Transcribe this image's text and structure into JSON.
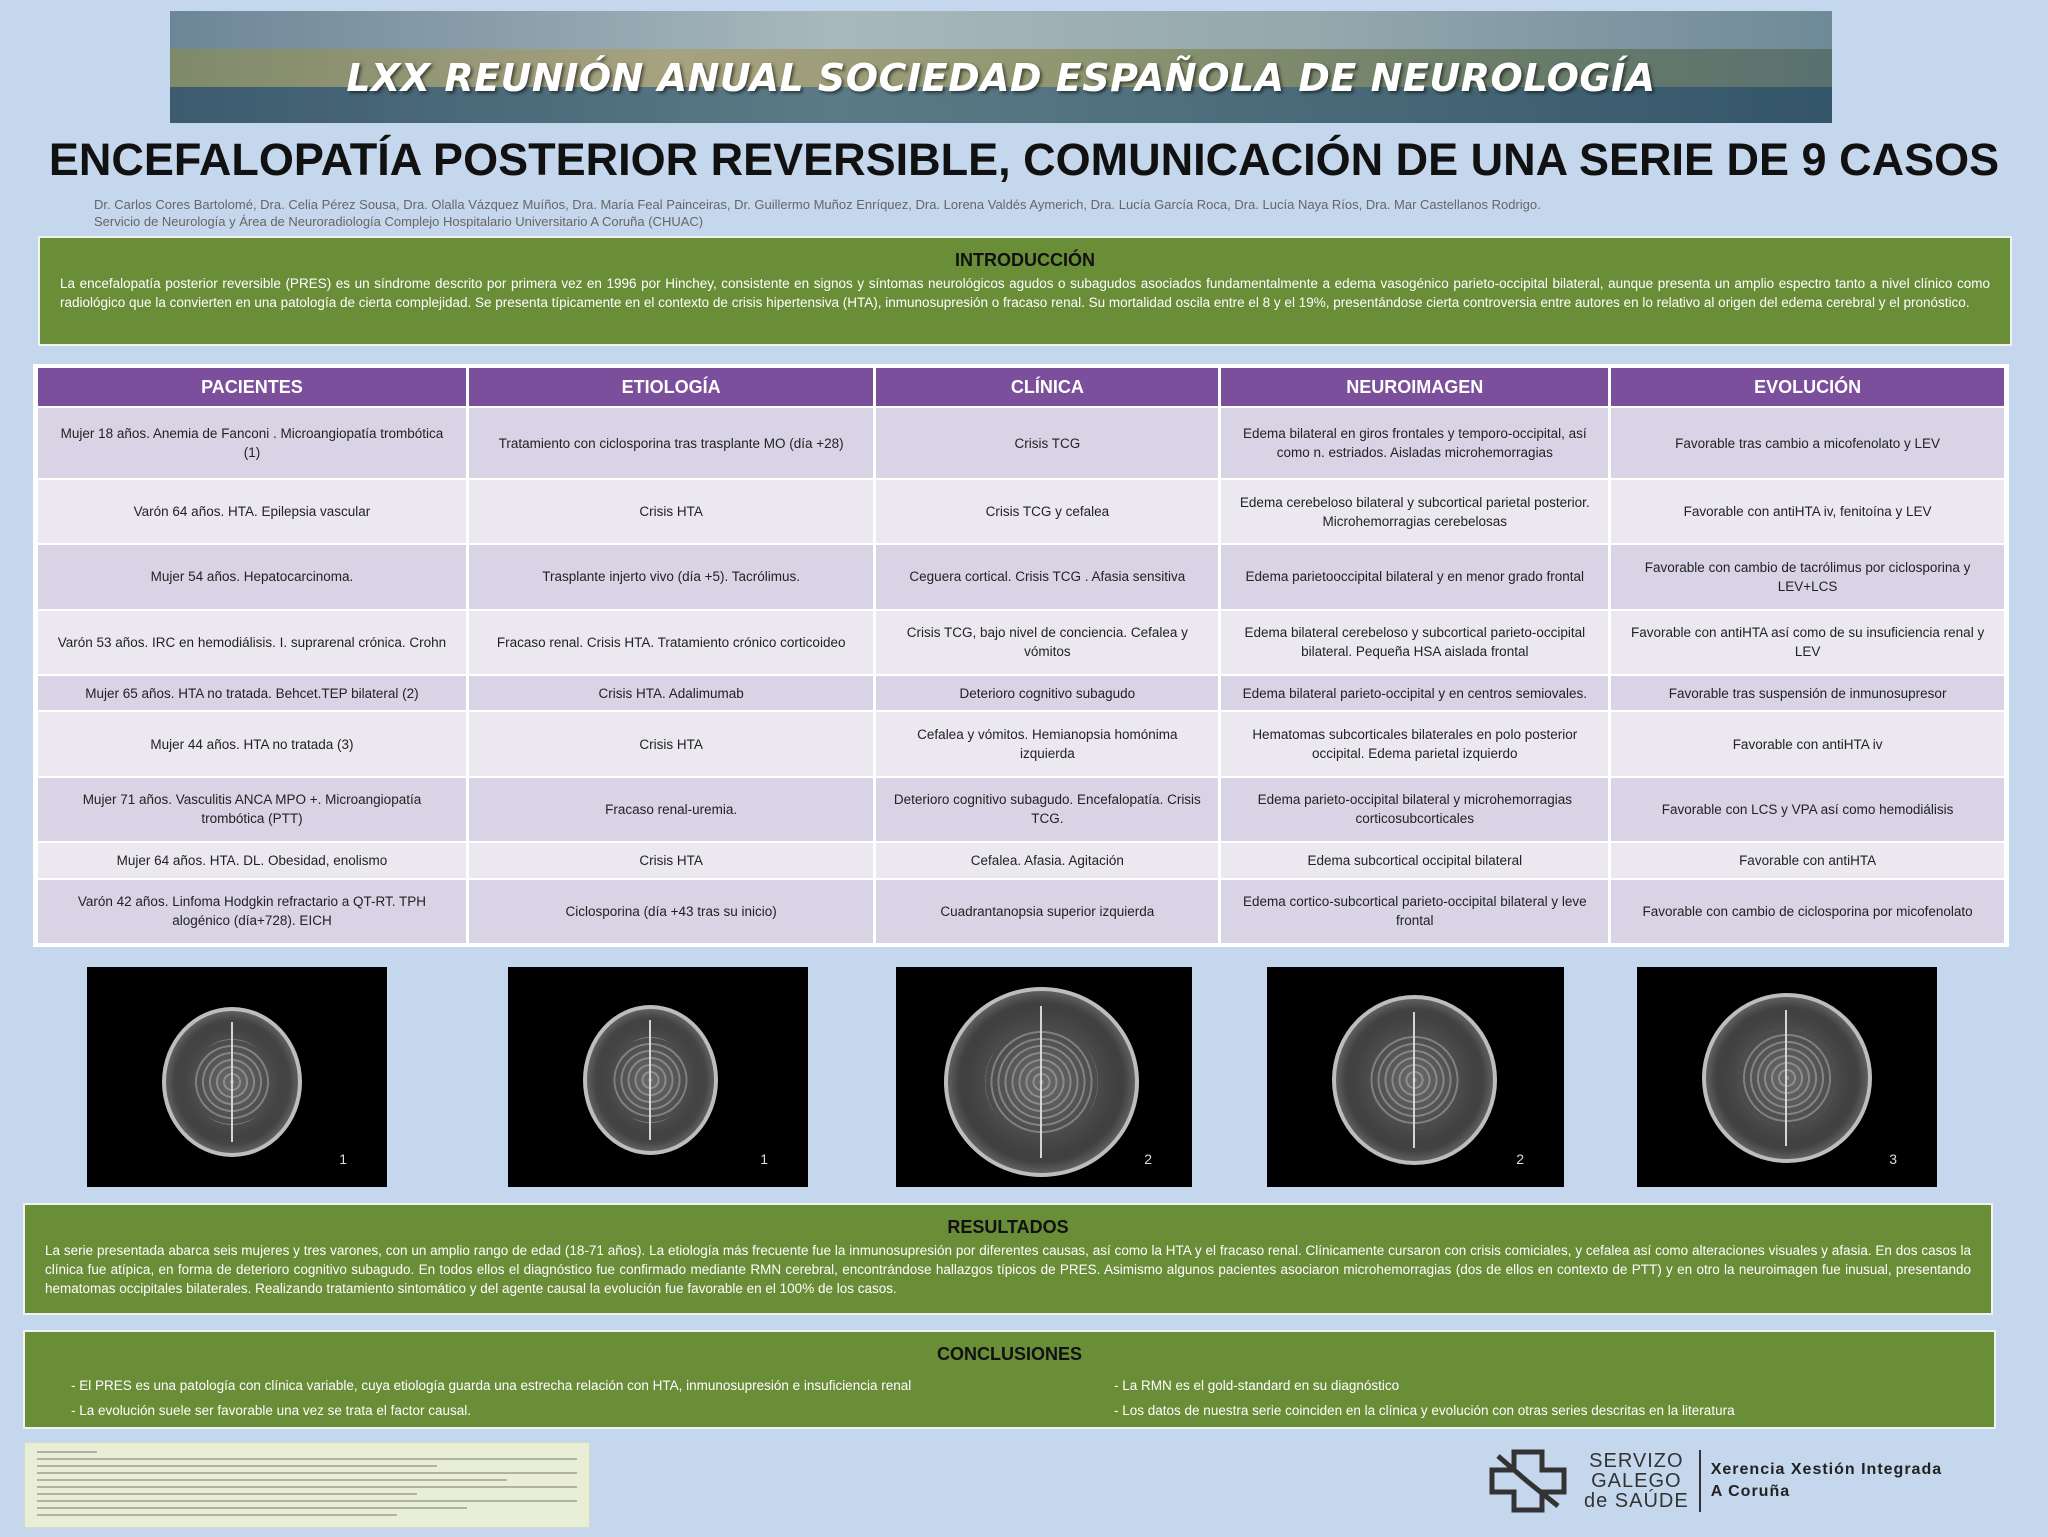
{
  "banner": {
    "title": "LXX REUNIÓN ANUAL SOCIEDAD ESPAÑOLA DE NEUROLOGÍA"
  },
  "title": "ENCEFALOPATÍA POSTERIOR REVERSIBLE, COMUNICACIÓN DE UNA SERIE DE 9 CASOS",
  "authors": {
    "line1": "Dr. Carlos Cores Bartolomé, Dra. Celia Pérez Sousa, Dra. Olalla Vázquez Muíños, Dra. María Feal Painceiras, Dr. Guillermo Muñoz Enríquez, Dra. Lorena Valdés Aymerich, Dra. Lucía García Roca, Dra. Lucía Naya Ríos, Dra. Mar Castellanos Rodrigo.",
    "line2": "Servicio de Neurología y Área de Neuroradiología Complejo Hospitalario Universitario A Coruña (CHUAC)"
  },
  "intro": {
    "heading": "INTRODUCCIÓN",
    "text": "La encefalopatía posterior reversible (PRES) es un síndrome descrito por primera vez en 1996 por Hinchey, consistente en signos y síntomas neurológicos agudos o subagudos asociados fundamentalmente a edema vasogénico parieto-occipital bilateral, aunque presenta un amplio espectro tanto a nivel clínico como radiológico que la convierten en una patología de cierta complejidad. Se presenta típicamente en el contexto de crisis hipertensiva (HTA), inmunosupresión o fracaso renal. Su mortalidad oscila entre el 8 y el 19%, presentándose cierta controversia entre autores en lo relativo al origen del edema cerebral y el pronóstico."
  },
  "table": {
    "headers": [
      "PACIENTES",
      "ETIOLOGÍA",
      "CLÍNICA",
      "NEUROIMAGEN",
      "EVOLUCIÓN"
    ],
    "rows": [
      [
        "Mujer 18 años. Anemia de Fanconi . Microangiopatía trombótica (1)",
        "Tratamiento con ciclosporina tras trasplante MO (día +28)",
        "Crisis TCG",
        "Edema bilateral en giros frontales y temporo-occipital, así como n. estriados. Aisladas microhemorragias",
        "Favorable tras cambio a micofenolato y LEV"
      ],
      [
        "Varón 64 años. HTA. Epilepsia vascular",
        "Crisis HTA",
        "Crisis TCG y cefalea",
        "Edema cerebeloso bilateral y subcortical parietal posterior. Microhemorragias cerebelosas",
        "Favorable con antiHTA iv, fenitoína y LEV"
      ],
      [
        "Mujer 54 años. Hepatocarcinoma.",
        "Trasplante injerto vivo (día +5). Tacrólimus.",
        "Ceguera cortical. Crisis TCG . Afasia sensitiva",
        "Edema parietooccipital bilateral y en menor grado frontal",
        "Favorable con cambio de tacrólimus por ciclosporina y LEV+LCS"
      ],
      [
        "Varón 53 años. IRC en hemodiálisis. I. suprarenal crónica. Crohn",
        "Fracaso renal. Crisis HTA. Tratamiento crónico corticoideo",
        "Crisis TCG, bajo nivel de conciencia. Cefalea y vómitos",
        "Edema bilateral cerebeloso y subcortical parieto-occipital bilateral. Pequeña HSA aislada frontal",
        "Favorable con antiHTA así como de su insuficiencia renal y LEV"
      ],
      [
        "Mujer 65 años. HTA no tratada. Behcet.TEP bilateral (2)",
        "Crisis HTA. Adalimumab",
        "Deterioro cognitivo subagudo",
        "Edema bilateral parieto-occipital y en centros semiovales.",
        "Favorable tras suspensión de inmunosupresor"
      ],
      [
        "Mujer 44 años. HTA no tratada (3)",
        "Crisis HTA",
        "Cefalea y vómitos. Hemianopsia homónima izquierda",
        "Hematomas subcorticales bilaterales en polo posterior occipital. Edema parietal izquierdo",
        "Favorable con antiHTA iv"
      ],
      [
        "Mujer 71 años. Vasculitis ANCA MPO +. Microangiopatía trombótica (PTT)",
        "Fracaso renal-uremia.",
        "Deterioro cognitivo subagudo. Encefalopatía. Crisis TCG.",
        "Edema parieto-occipital bilateral y microhemorragias corticosubcorticales",
        "Favorable con LCS y VPA así como hemodiálisis"
      ],
      [
        "Mujer 64 años. HTA. DL. Obesidad, enolismo",
        "Crisis HTA",
        "Cefalea. Afasia. Agitación",
        "Edema subcortical occipital bilateral",
        "Favorable con antiHTA"
      ],
      [
        "Varón 42 años. Linfoma Hodgkin refractario a QT-RT. TPH alogénico (día+728). EICH",
        "Ciclosporina (día +43 tras su inicio)",
        "Cuadrantanopsia superior izquierda",
        "Edema cortico-subcortical parieto-occipital bilateral y leve frontal",
        "Favorable con cambio de ciclosporina por micofenolato"
      ]
    ]
  },
  "images": [
    {
      "label": "1"
    },
    {
      "label": "1"
    },
    {
      "label": "2"
    },
    {
      "label": "2"
    },
    {
      "label": "3"
    }
  ],
  "results": {
    "heading": "RESULTADOS",
    "text": "La serie presentada abarca seis mujeres y tres varones, con un amplio rango de edad (18-71 años). La etiología más frecuente fue la inmunosupresión por diferentes causas, así como la HTA y el fracaso renal. Clínicamente cursaron con crisis comiciales, y cefalea así como alteraciones visuales y afasia. En dos casos la clínica fue atípica, en forma de deterioro cognitivo subagudo. En todos ellos el diagnóstico fue confirmado mediante RMN cerebral, encontrándose hallazgos típicos de PRES. Asimismo algunos pacientes asociaron microhemorragias (dos de ellos en contexto de PTT) y en otro la neuroimagen fue inusual, presentando hematomas occipitales bilaterales. Realizando tratamiento sintomático y del agente causal la evolución fue favorable en el 100% de los casos."
  },
  "conclusions": {
    "heading": "CONCLUSIONES",
    "left": [
      "- El PRES es una patología con clínica variable, cuya etiología guarda una estrecha relación con HTA, inmunosupresión e insuficiencia renal",
      "- La evolución suele ser favorable una vez se trata el factor causal."
    ],
    "right": [
      "- La RMN es el gold-standard en su diagnóstico",
      "- Los datos de nuestra serie coinciden en la clínica y evolución con otras series descritas en la literatura"
    ]
  },
  "logo": {
    "sgs": [
      "SERVIZO",
      "GALEGO",
      "de SAÚDE"
    ],
    "xerencia": [
      "Xerencia Xestión Integrada",
      "A Coruña"
    ]
  },
  "colors": {
    "background": "#c5d7ec",
    "green_box": "#6a8d38",
    "table_header": "#7c4f9c",
    "row_odd": "#d9d3e6",
    "row_even": "#ebe8f0"
  }
}
